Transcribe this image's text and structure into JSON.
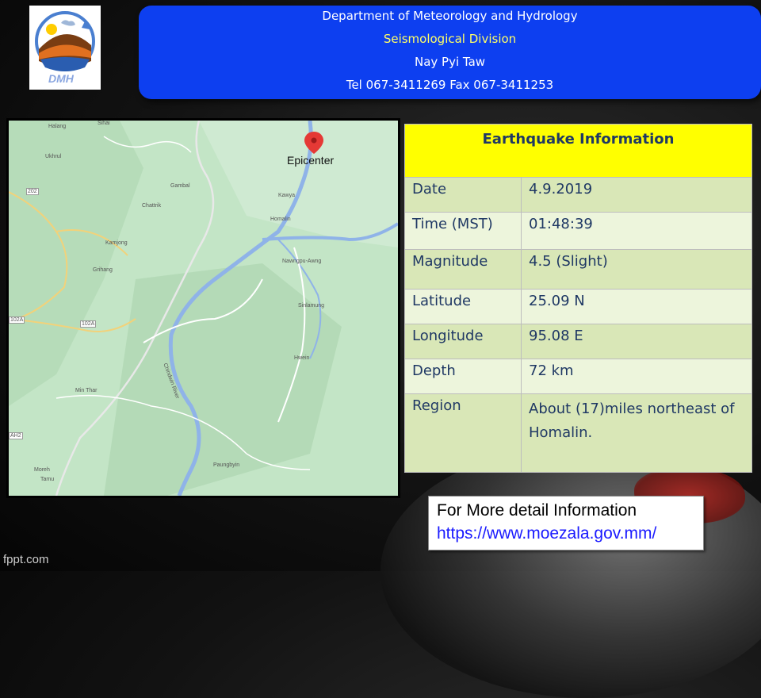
{
  "header": {
    "line1": "Department of Meteorology and Hydrology",
    "line2": "Seismological Division",
    "line3": "Nay Pyi Taw",
    "line4": "Tel 067-3411269 Fax 067-3411253",
    "logo_text": "DMH",
    "line2_color": "#ffff66",
    "background": "#0d3ff0"
  },
  "map": {
    "epicenter_label": "Epicenter",
    "places": [
      "Halang",
      "Sihai",
      "Ukhrul",
      "Gambal",
      "Kawya",
      "Chattrik",
      "Homalin",
      "Kamjong",
      "Nawngpu-Awng",
      "Grihang",
      "Sinlamung",
      "Chindwin River",
      "Hwein",
      "Min Thar",
      "Paungbyin",
      "Moreh",
      "Tamu"
    ],
    "road_labels": [
      "202",
      "102A",
      "102A",
      "AH2"
    ]
  },
  "info": {
    "title": "Earthquake Information",
    "rows": [
      {
        "key": "Date",
        "value": "4.9.2019"
      },
      {
        "key": "Time (MST)",
        "value": "01:48:39"
      },
      {
        "key": "Magnitude",
        "value": "4.5 (Slight)"
      },
      {
        "key": "Latitude",
        "value": "25.09 N"
      },
      {
        "key": "Longitude",
        "value": "95.08 E"
      },
      {
        "key": "Depth",
        "value": "72 km"
      },
      {
        "key": "Region",
        "value": "About (17)miles northeast of Homalin."
      }
    ]
  },
  "more_info": {
    "line1": "For More detail Information",
    "link": "https://www.moezala.gov.mm/"
  },
  "footer": {
    "watermark": "fppt.com"
  }
}
